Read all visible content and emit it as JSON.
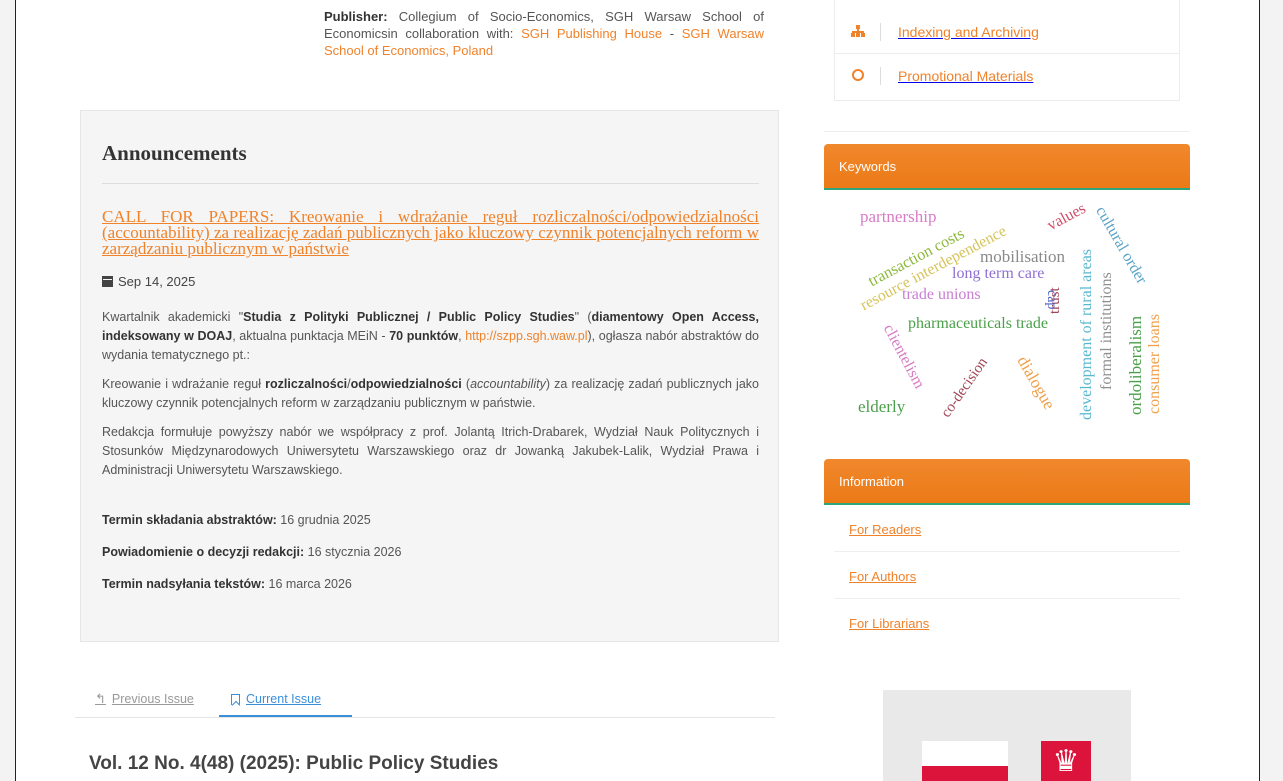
{
  "publisher": {
    "label": "Publisher:",
    "text": "Collegium of Socio-Economics, SGH Warsaw School of Economicsin collaboration with: ",
    "link1": "SGH Publishing House",
    "sep": " - ",
    "link2": "SGH Warsaw School of Economics, Poland"
  },
  "announcements": {
    "heading": "Announcements",
    "title": "CALL FOR PAPERS: Kreowanie i wdrażanie reguł rozliczalności/odpowiedzialności (accountability) za realizację zadań publicznych jako kluczowy czynnik potencjalnych reform w zarządzaniu publicznym w państwie",
    "date": "Sep 14, 2025",
    "p1": {
      "a": "Kwartalnik akademicki \"",
      "b": "Studia z Polityki Publicznej / Public Policy Studies",
      "c": "\" (",
      "d": "diamentowy Open Access, indeksowany w DOAJ",
      "e": ", aktualna punktacja MEiN - ",
      "f": "70 punktów",
      "g": ", ",
      "link": "http://szpp.sgh.waw.pl",
      "h": "), ogłasza nabór abstraktów do wydania tematycznego pt.:"
    },
    "p2": {
      "a": "Kreowanie i wdrażanie reguł ",
      "b": "rozliczalności",
      "c": "/",
      "d": "odpowiedzialności",
      "e": " (",
      "f": "accountability",
      "g": ") za realizację zadań publicznych jako kluczowy czynnik potencjalnych reform w zarządzaniu publicznym w państwie."
    },
    "p3": "Redakcja formułuje powyższy nabór we współpracy z prof. Jolantą Itrich-Drabarek, Wydział Nauk Politycznych i Stosunków Międzynarodowych Uniwersytetu Warszawskiego oraz dr Jowanką Jakubek-Lalik, Wydział Prawa i Administracji Uniwersytetu Warszawskiego.",
    "deadlines": [
      {
        "label": "Termin składania abstraktów:",
        "value": " 16 grudnia 2025"
      },
      {
        "label": "Powiadomienie o decyzji redakcji:",
        "value": " 16 stycznia 2026"
      },
      {
        "label": "Termin nadsyłania tekstów:",
        "value": " 16 marca 2026"
      }
    ]
  },
  "tabs": {
    "previous": "Previous Issue",
    "current": "Current Issue"
  },
  "issue_title": "Vol. 12 No. 4(48) (2025): Public Policy Studies",
  "sidebar": {
    "menu": [
      {
        "label": "Indexing and Archiving",
        "icon": "sitemap-icon"
      },
      {
        "label": "Promotional Materials",
        "icon": "circle-icon"
      }
    ],
    "keywords_title": "Keywords",
    "keywords": [
      "partnership",
      "transaction costs",
      "resource interdependence",
      "values",
      "cultural order",
      "mobilisation",
      "long term care",
      "trade unions",
      "trust",
      "cap",
      "development of rural areas",
      "formal institutions",
      "ordoliberalism",
      "consumer loans",
      "pharmaceuticals trade",
      "clientelism",
      "co-decision",
      "dialogue",
      "elderly"
    ],
    "information_title": "Information",
    "information": [
      "For Readers",
      "For Authors",
      "For Librarians"
    ]
  },
  "colors": {
    "accent": "#f0822a",
    "link_blue": "#3b8fd9",
    "header_border": "#2ea57a"
  }
}
